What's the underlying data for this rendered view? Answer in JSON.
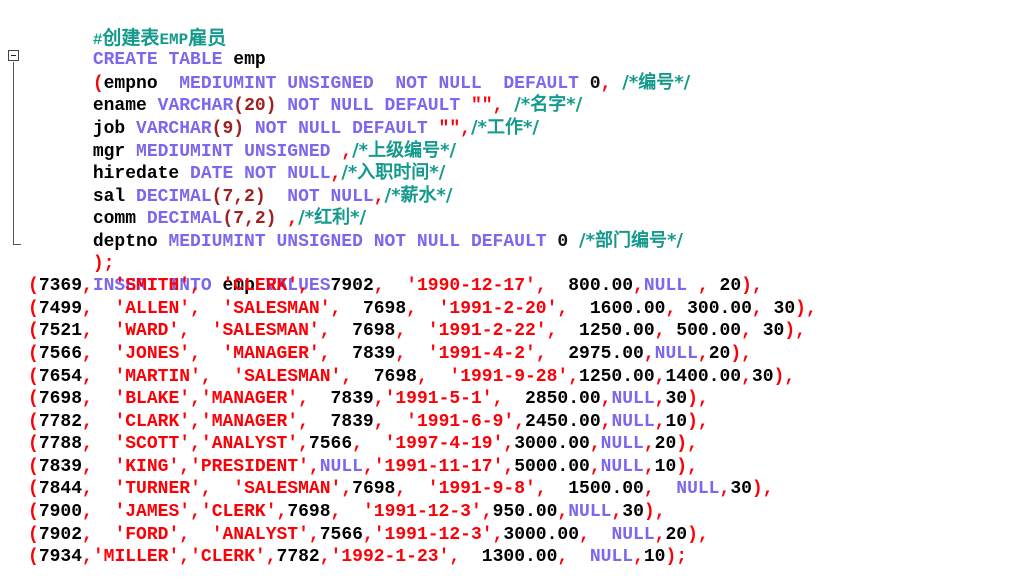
{
  "editor": {
    "language": "sql",
    "colors": {
      "keyword": "#7b68ee",
      "identifier": "#000000",
      "string": "#fb0007",
      "comment": "#149a8c",
      "number_in_type": "#a02020",
      "number": "#000000",
      "background": "#ffffff"
    },
    "fold_marker": "minus-box"
  },
  "code": {
    "header_comment": {
      "hash": "#",
      "cjk_1": "创建表",
      "latin": "EMP",
      "cjk_2": "雇员"
    },
    "lines": [
      {
        "id": "line-create-table",
        "text": "CREATE TABLE emp"
      },
      {
        "id": "line-empno",
        "text": "(empno  MEDIUMINT UNSIGNED  NOT NULL  DEFAULT 0, /*编号*/"
      },
      {
        "id": "line-ename",
        "text": "ename VARCHAR(20) NOT NULL DEFAULT \"\", /*名字*/"
      },
      {
        "id": "line-job",
        "text": "job VARCHAR(9) NOT NULL DEFAULT \"\",/*工作*/"
      },
      {
        "id": "line-mgr",
        "text": "mgr MEDIUMINT UNSIGNED ,/*上级编号*/"
      },
      {
        "id": "line-hiredate",
        "text": "hiredate DATE NOT NULL,/*入职时间*/"
      },
      {
        "id": "line-sal",
        "text": "sal DECIMAL(7,2)  NOT NULL,/*薪水*/"
      },
      {
        "id": "line-comm",
        "text": "comm DECIMAL(7,2) ,/*红利*/"
      },
      {
        "id": "line-deptno",
        "text": "deptno MEDIUMINT UNSIGNED NOT NULL DEFAULT 0 /*部门编号*/"
      },
      {
        "id": "line-close-paren",
        "text": ");"
      },
      {
        "id": "line-insert",
        "text": "INSERT INTO emp VALUES"
      }
    ],
    "tokens": {
      "create": "CREATE",
      "table": "TABLE",
      "emp": "emp",
      "insert": "INSERT",
      "into": "INTO",
      "values": "VALUES",
      "open_paren": "(",
      "close_paren_semi": ");",
      "empno": "empno",
      "ename": "ename",
      "job": "job",
      "mgr": "mgr",
      "hiredate": "hiredate",
      "sal": "sal",
      "comm": "comm",
      "deptno": "deptno",
      "mediumint": "MEDIUMINT",
      "unsigned": "UNSIGNED",
      "not_null": "NOT NULL",
      "default": "DEFAULT",
      "varchar": "VARCHAR",
      "decimal": "DECIMAL",
      "date": "DATE",
      "empty_string": "\"\"",
      "zero": "0",
      "paren20": "(20)",
      "paren9": "(9)",
      "paren72": "(7,2)",
      "comment_empno": "/*编号*/",
      "comment_ename": "/*名字*/",
      "comment_job": "/*工作*/",
      "comment_mgr": "/*上级编号*/",
      "comment_hiredate": "/*入职时间*/",
      "comment_sal": "/*薪水*/",
      "comment_comm": "/*红利*/",
      "comment_deptno": "/*部门编号*/"
    },
    "rows": [
      {
        "empno": "7369",
        "ename": "'SMITH'",
        "job": "'CLERK'",
        "mgr": "7902",
        "hiredate": "'1990-12-17'",
        "sal": "800.00",
        "comm": "NULL",
        "deptno": "20",
        "raw": "(7369,  'SMITH',  'CLERK',  7902,  '1990-12-17',  800.00,NULL , 20),"
      },
      {
        "empno": "7499",
        "ename": "'ALLEN'",
        "job": "'SALESMAN'",
        "mgr": "7698",
        "hiredate": "'1991-2-20'",
        "sal": "1600.00",
        "comm": "300.00",
        "deptno": "30",
        "raw": "(7499,  'ALLEN',  'SALESMAN',  7698,  '1991-2-20',  1600.00, 300.00, 30),"
      },
      {
        "empno": "7521",
        "ename": "'WARD'",
        "job": "'SALESMAN'",
        "mgr": "7698",
        "hiredate": "'1991-2-22'",
        "sal": "1250.00",
        "comm": "500.00",
        "deptno": "30",
        "raw": "(7521,  'WARD',  'SALESMAN',  7698,  '1991-2-22',  1250.00, 500.00, 30),"
      },
      {
        "empno": "7566",
        "ename": "'JONES'",
        "job": "'MANAGER'",
        "mgr": "7839",
        "hiredate": "'1991-4-2'",
        "sal": "2975.00",
        "comm": "NULL",
        "deptno": "20",
        "raw": "(7566,  'JONES',  'MANAGER',  7839,  '1991-4-2',  2975.00,NULL,20),"
      },
      {
        "empno": "7654",
        "ename": "'MARTIN'",
        "job": "'SALESMAN'",
        "mgr": "7698",
        "hiredate": "'1991-9-28'",
        "sal": "1250.00",
        "comm": "1400.00",
        "deptno": "30",
        "raw": "(7654,  'MARTIN',  'SALESMAN',  7698,  '1991-9-28',1250.00,1400.00,30),"
      },
      {
        "empno": "7698",
        "ename": "'BLAKE'",
        "job": "'MANAGER'",
        "mgr": "7839",
        "hiredate": "'1991-5-1'",
        "sal": "2850.00",
        "comm": "NULL",
        "deptno": "30",
        "raw": "(7698,  'BLAKE','MANAGER',  7839,'1991-5-1',  2850.00,NULL,30),"
      },
      {
        "empno": "7782",
        "ename": "'CLARK'",
        "job": "'MANAGER'",
        "mgr": "7839",
        "hiredate": "'1991-6-9'",
        "sal": "2450.00",
        "comm": "NULL",
        "deptno": "10",
        "raw": "(7782,  'CLARK','MANAGER',  7839,  '1991-6-9',2450.00,NULL,10),"
      },
      {
        "empno": "7788",
        "ename": "'SCOTT'",
        "job": "'ANALYST'",
        "mgr": "7566",
        "hiredate": "'1997-4-19'",
        "sal": "3000.00",
        "comm": "NULL",
        "deptno": "20",
        "raw": "(7788,  'SCOTT','ANALYST',7566,  '1997-4-19',3000.00,NULL,20),"
      },
      {
        "empno": "7839",
        "ename": "'KING'",
        "job": "'PRESIDENT'",
        "mgr": "NULL",
        "hiredate": "'1991-11-17'",
        "sal": "5000.00",
        "comm": "NULL",
        "deptno": "10",
        "raw": "(7839,  'KING','PRESIDENT',NULL,'1991-11-17',5000.00,NULL,10),"
      },
      {
        "empno": "7844",
        "ename": "'TURNER'",
        "job": "'SALESMAN'",
        "mgr": "7698",
        "hiredate": "'1991-9-8'",
        "sal": "1500.00",
        "comm": "NULL",
        "deptno": "30",
        "raw": "(7844,  'TURNER',  'SALESMAN',7698,  '1991-9-8',  1500.00,  NULL,30),"
      },
      {
        "empno": "7900",
        "ename": "'JAMES'",
        "job": "'CLERK'",
        "mgr": "7698",
        "hiredate": "'1991-12-3'",
        "sal": "950.00",
        "comm": "NULL",
        "deptno": "30",
        "raw": "(7900,  'JAMES','CLERK',7698,  '1991-12-3',950.00,NULL,30),"
      },
      {
        "empno": "7902",
        "ename": "'FORD'",
        "job": "'ANALYST'",
        "mgr": "7566",
        "hiredate": "'1991-12-3'",
        "sal": "3000.00",
        "comm": "NULL",
        "deptno": "20",
        "raw": "(7902,  'FORD',  'ANALYST',7566,'1991-12-3',3000.00,  NULL,20),"
      },
      {
        "empno": "7934",
        "ename": "'MILLER'",
        "job": "'CLERK'",
        "mgr": "7782",
        "hiredate": "'1992-1-23'",
        "sal": "1300.00",
        "comm": "NULL",
        "deptno": "10",
        "raw": "(7934,'MILLER','CLERK',7782,'1992-1-23',  1300.00,  NULL,10);"
      }
    ],
    "row_terminators": [
      ",",
      ",",
      ",",
      ",",
      ",",
      ",",
      ",",
      ",",
      ",",
      ",",
      ",",
      ",",
      ";"
    ],
    "null_literal": "NULL"
  }
}
